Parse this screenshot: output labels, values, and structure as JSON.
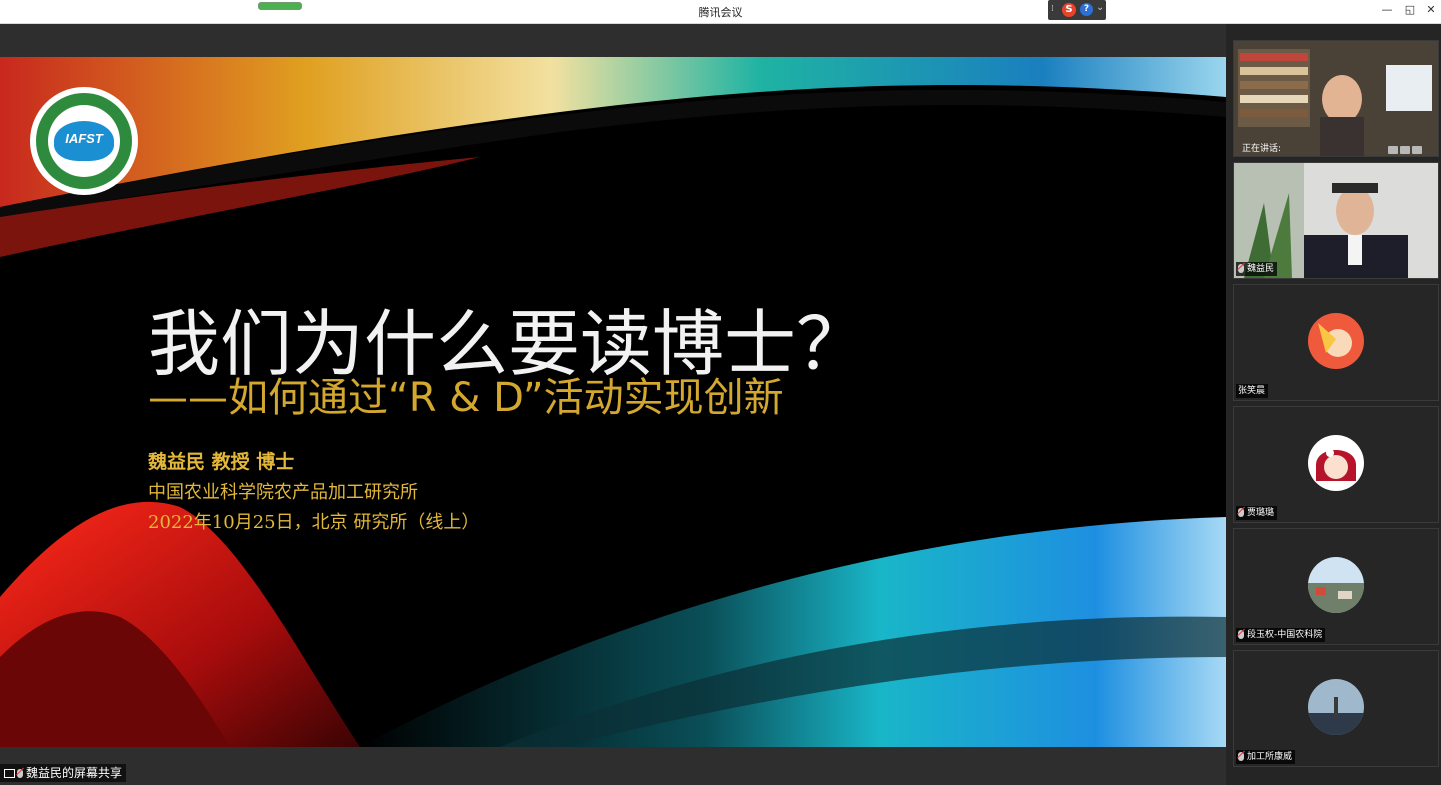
{
  "window": {
    "title": "腾讯会议",
    "min_glyph": "—",
    "restore_glyph": "◱",
    "close_glyph": "✕"
  },
  "ime": {
    "s_label": "S",
    "help_label": "?"
  },
  "slide": {
    "title": "我们为什么要读博士？",
    "subtitle": "——如何通过“R & D”活动实现创新",
    "author": "魏益民  教授  博士",
    "institution": "中国农业科学院农产品加工研究所",
    "date_line": "2022年10月25日，北京  研究所（线上）",
    "logo_abbr": "IAFST",
    "colors": {
      "title": "#f2f2f2",
      "accent": "#e2b73a",
      "background": "#000000"
    }
  },
  "share_indicator": {
    "label": "魏益民的屏幕共享"
  },
  "participants": {
    "speaking_label": "正在讲话:",
    "tiles": [
      {
        "name": "魏益民"
      },
      {
        "name": "张笑晨"
      },
      {
        "name": "贾璐璐"
      },
      {
        "name": "段玉权-中国农科院"
      },
      {
        "name": "加工所康威"
      }
    ]
  }
}
